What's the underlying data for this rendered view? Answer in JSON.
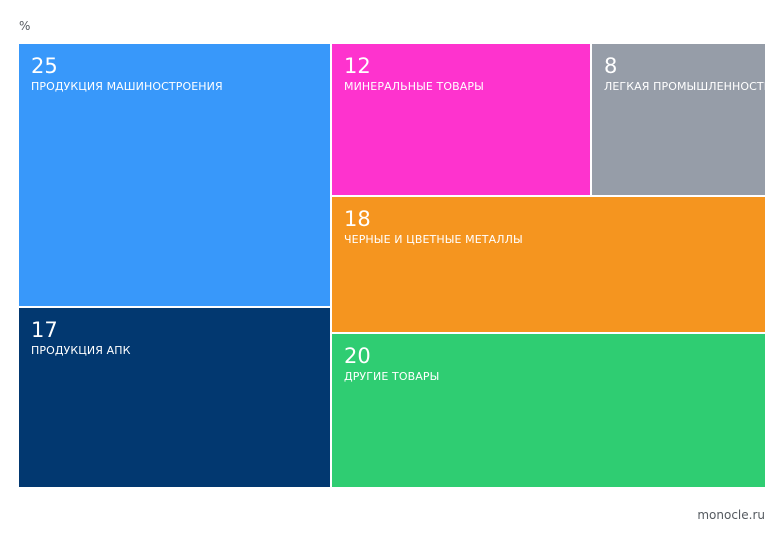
{
  "unit_label": "%",
  "source": "monocle.ru",
  "chart_data": {
    "type": "treemap",
    "unit": "%",
    "items": [
      {
        "value": 25,
        "label": "ПРОДУКЦИЯ МАШИНОСТРОЕНИЯ",
        "color": "#3898fa"
      },
      {
        "value": 17,
        "label": "ПРОДУКЦИЯ АПК",
        "color": "#023870"
      },
      {
        "value": 12,
        "label": "МИНЕРАЛЬНЫЕ ТОВАРЫ",
        "color": "#fe33ce"
      },
      {
        "value": 8,
        "label": "ЛЕГКАЯ ПРОМЫШЛЕННОСТЬ",
        "color": "#969da8"
      },
      {
        "value": 18,
        "label": "ЧЕРНЫЕ И ЦВЕТНЫЕ МЕТАЛЛЫ",
        "color": "#f5951f"
      },
      {
        "value": 20,
        "label": "ДРУГИЕ ТОВАРЫ",
        "color": "#2fcd72"
      }
    ]
  }
}
